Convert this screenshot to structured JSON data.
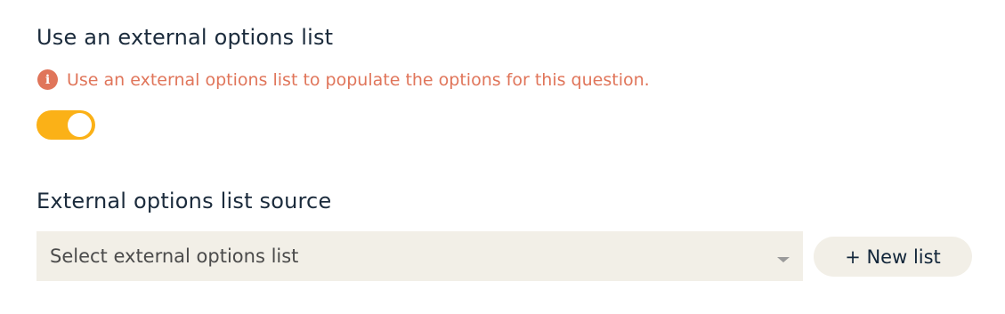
{
  "external_list_toggle": {
    "title": "Use an external options list",
    "hint": "Use an external options list to populate the options for this question.",
    "hint_icon": "info-icon",
    "enabled": true,
    "toggle_color": "#fbb117"
  },
  "source": {
    "title": "External options list source",
    "select_placeholder": "Select external options list",
    "caret_icon": "chevron-down-icon",
    "new_list_label": "+ New list"
  },
  "colors": {
    "hint": "#e0755a",
    "field_background": "#f2efe7",
    "text": "#1b2b3c"
  }
}
